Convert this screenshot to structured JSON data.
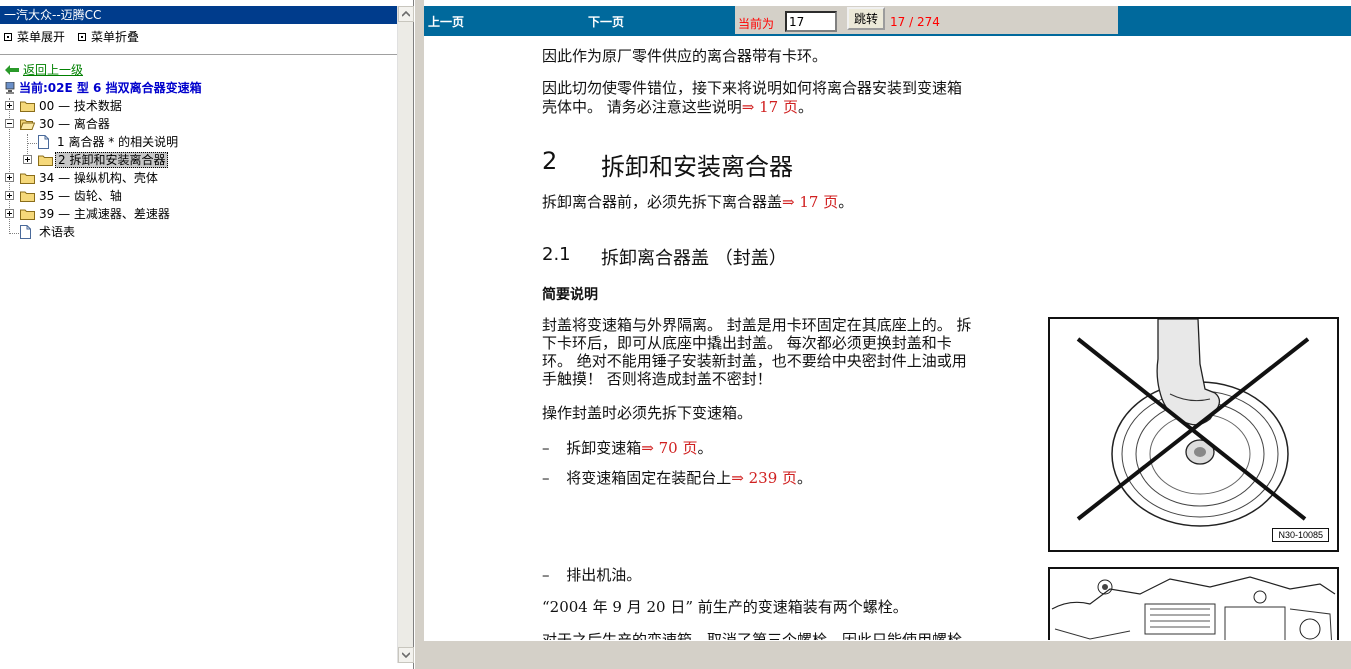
{
  "left": {
    "title": "一汽大众--迈腾CC",
    "menu_expand": "菜单展开",
    "menu_collapse": "菜单折叠",
    "back": "返回上一级",
    "current": "当前:02E 型  6 挡双离合器变速箱",
    "tree": [
      {
        "label": "00 — 技术数据"
      },
      {
        "label": "30 — 离合器"
      },
      {
        "label": "1 离合器 * 的相关说明"
      },
      {
        "label": "2 拆卸和安装离合器"
      },
      {
        "label": "34 — 操纵机构、壳体"
      },
      {
        "label": "35 — 齿轮、轴"
      },
      {
        "label": "39 — 主减速器、差速器"
      },
      {
        "label": "术语表"
      }
    ]
  },
  "toolbar": {
    "prev": "上一页",
    "next": "下一页",
    "current_label": "当前为",
    "page_value": "17",
    "jump": "跳转",
    "page_count": "17 / 274"
  },
  "doc": {
    "p1": "因此作为原厂零件供应的离合器带有卡环。",
    "p2a": "因此切勿使零件错位，接下来将说明如何将离合器安装到变速箱",
    "p2b": "壳体中。 请务必注意这些说明",
    "p2ref": "⇒ 17 页",
    "p2end": "。",
    "h_num": "2",
    "h_title": "拆卸和安装离合器",
    "p3": "拆卸离合器前，必须先拆下离合器盖",
    "p3ref": "⇒ 17 页",
    "p3end": "。",
    "h2_num": "2.1",
    "h2_title": "拆卸离合器盖 （封盖）",
    "h3": "简要说明",
    "p4a": "封盖将变速箱与外界隔离。 封盖是用卡环固定在其底座上的。 拆",
    "p4b": "下卡环后，即可从底座中撬出封盖。 每次都必须更换封盖和卡",
    "p4c": "环。 绝对不能用锤子安装新封盖，也不要给中央密封件上油或用",
    "p4d": "手触摸！  否则将造成封盖不密封！",
    "p5": "操作封盖时必须先拆下变速箱。",
    "b1_dash": "–",
    "b1": "拆卸变速箱",
    "b1ref": "⇒ 70 页",
    "b1end": "。",
    "b2_dash": "–",
    "b2": "将变速箱固定在装配台上",
    "b2ref": "⇒ 239 页",
    "b2end": "。",
    "b3_dash": "–",
    "b3": "排出机油。",
    "p6": "“2004  年  9  月  20  日”  前生产的变速箱装有两个螺栓。",
    "p7": "对于之后生产的变速箱，取消了第三个螺栓，因此只能使用螺栓",
    "fig1_label": "N30-10085"
  },
  "colors": {
    "left_title_bg": "#003c8c",
    "toolbar_bg": "#00699c",
    "ref_red": "#d02020"
  }
}
